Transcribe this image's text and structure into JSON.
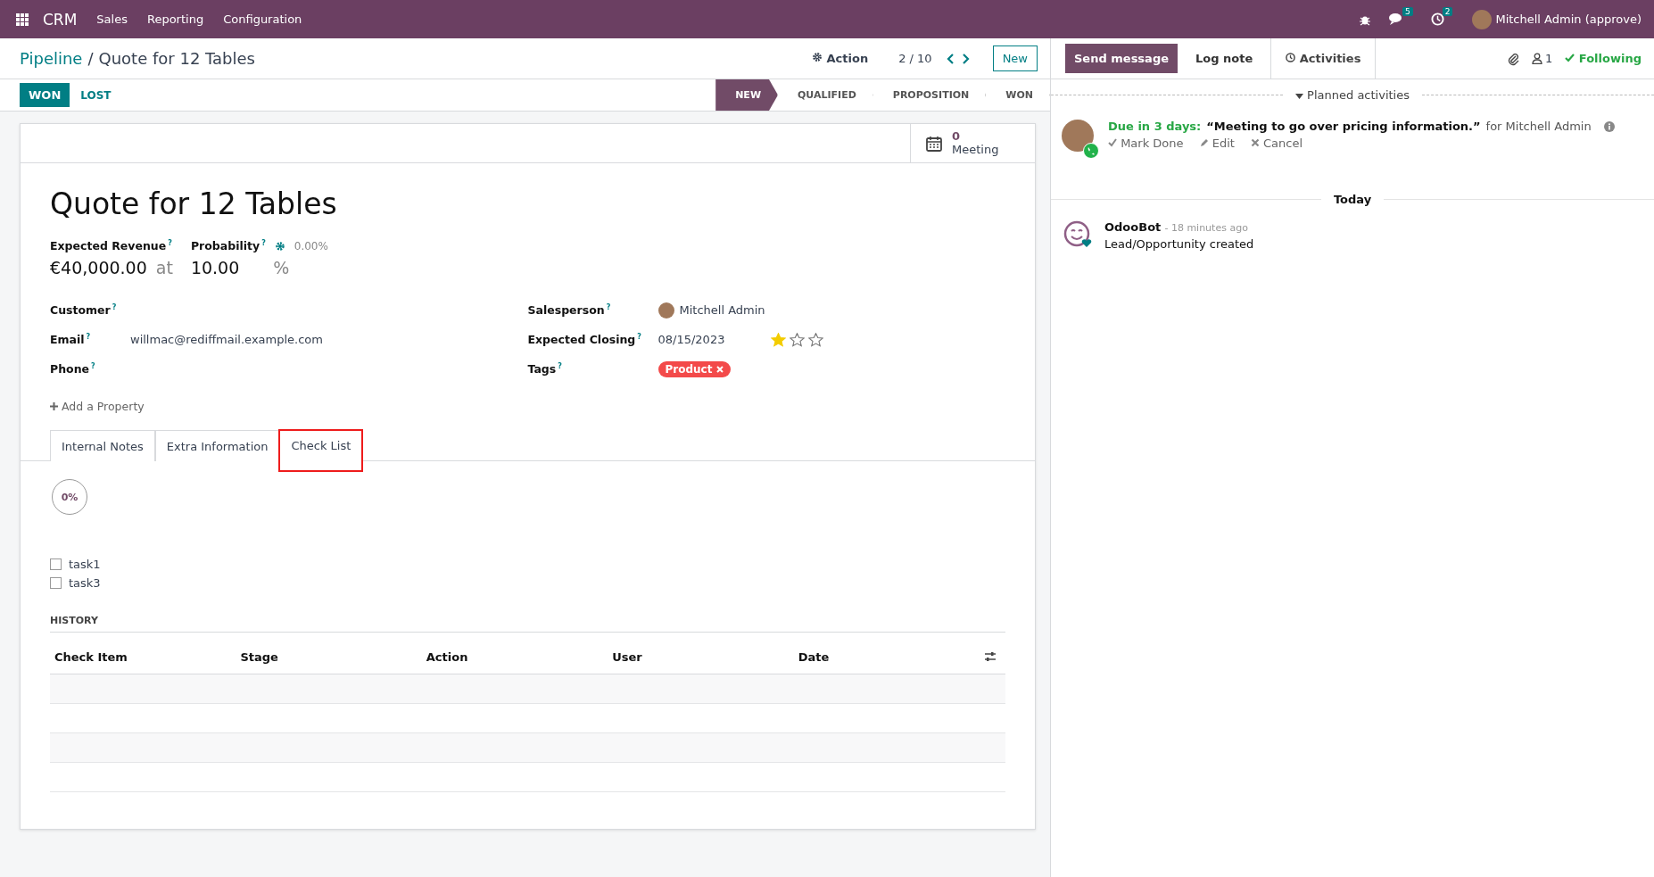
{
  "navbar": {
    "app": "CRM",
    "menu": [
      "Sales",
      "Reporting",
      "Configuration"
    ],
    "messages_badge": "5",
    "activities_badge": "2",
    "user": "Mitchell Admin (approve)"
  },
  "breadcrumb": {
    "parent": "Pipeline",
    "separator": "/",
    "current": "Quote for 12 Tables"
  },
  "toolbar": {
    "action": "Action",
    "pager": "2 / 10",
    "new": "New"
  },
  "status_buttons": [
    "WON",
    "LOST"
  ],
  "stages": [
    {
      "label": "NEW",
      "selected": true
    },
    {
      "label": "QUALIFIED",
      "selected": false
    },
    {
      "label": "PROPOSITION",
      "selected": false
    },
    {
      "label": "WON",
      "selected": false
    }
  ],
  "smart_button": {
    "count": "0",
    "label": "Meeting"
  },
  "title": "Quote for 12 Tables",
  "revenue": {
    "label": "Expected Revenue",
    "help": "?",
    "value": "€40,000.00",
    "at": "at"
  },
  "probability": {
    "label": "Probability",
    "help": "?",
    "auto": "0.00%",
    "value": "10.00",
    "unit": "%"
  },
  "left_fields": [
    {
      "label": "Customer",
      "help": "?"
    },
    {
      "label": "Email",
      "help": "?",
      "value": "willmac@rediffmail.example.com"
    },
    {
      "label": "Phone",
      "help": "?"
    }
  ],
  "salesperson": {
    "label": "Salesperson",
    "help": "?",
    "value": "Mitchell Admin"
  },
  "expected_closing": {
    "label": "Expected Closing",
    "help": "?",
    "value": "08/15/2023",
    "stars": 1
  },
  "tags": {
    "label": "Tags",
    "help": "?",
    "items": [
      {
        "label": "Product",
        "color": "#f34a4a"
      }
    ]
  },
  "add_property": "Add a Property",
  "tabs": [
    {
      "label": "Internal Notes",
      "selected": false,
      "highlighted": false
    },
    {
      "label": "Extra Information",
      "selected": false,
      "highlighted": false
    },
    {
      "label": "Check List",
      "selected": true,
      "highlighted": true
    }
  ],
  "progress": {
    "text": "0%",
    "level": 0
  },
  "checklist": [
    {
      "label": "task1",
      "checked": false
    },
    {
      "label": "task3",
      "checked": false
    }
  ],
  "history": {
    "title": "HISTORY",
    "columns": [
      "Check Item",
      "Stage",
      "Action",
      "User",
      "Date"
    ]
  },
  "chatter": {
    "send": "Send message",
    "log": "Log note",
    "activities": "Activities",
    "followers": "1",
    "following": "Following",
    "planned": "Planned activities",
    "activity": {
      "due": "Due in 3 days:",
      "summary": "“Meeting to go over pricing information.”",
      "for": "for Mitchell Admin",
      "actions": [
        "Mark Done",
        "Edit",
        "Cancel"
      ]
    },
    "date_divider": "Today",
    "message": {
      "author": "OdooBot",
      "time": "- 18 minutes ago",
      "body": "Lead/Opportunity created"
    }
  }
}
